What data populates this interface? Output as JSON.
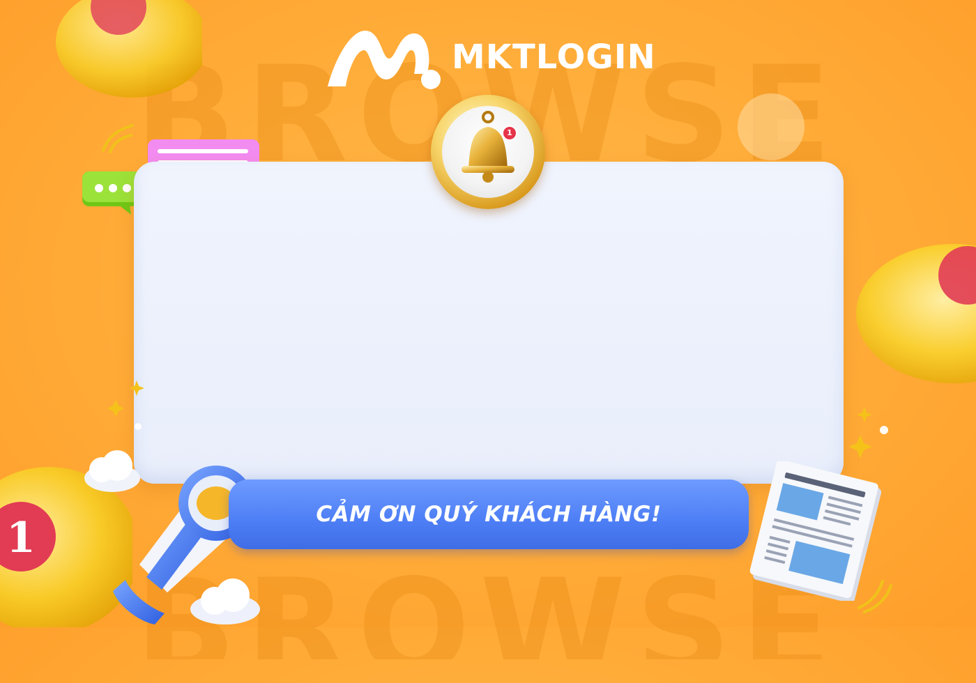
{
  "brand": {
    "name": "MKTLOGIN",
    "logo_icon": "mktlogin-m-logo-icon",
    "color_primary": "#ffffff",
    "background_color": "#ffab38"
  },
  "banner": {
    "text": "CẢM ƠN QUÝ KHÁCH HÀNG!",
    "color": "#4d7ef5"
  },
  "panel": {
    "color": "#eef2fc"
  },
  "notification": {
    "icon": "bell-icon",
    "badge_count": "1"
  },
  "decorations": {
    "background_words": [
      "BROWSE",
      "BROWSE"
    ],
    "icons": [
      "bell-icon",
      "megaphone-icon",
      "newspaper-icon",
      "chat-bubble-icon",
      "cloud-icon",
      "sparkle-icon"
    ]
  }
}
